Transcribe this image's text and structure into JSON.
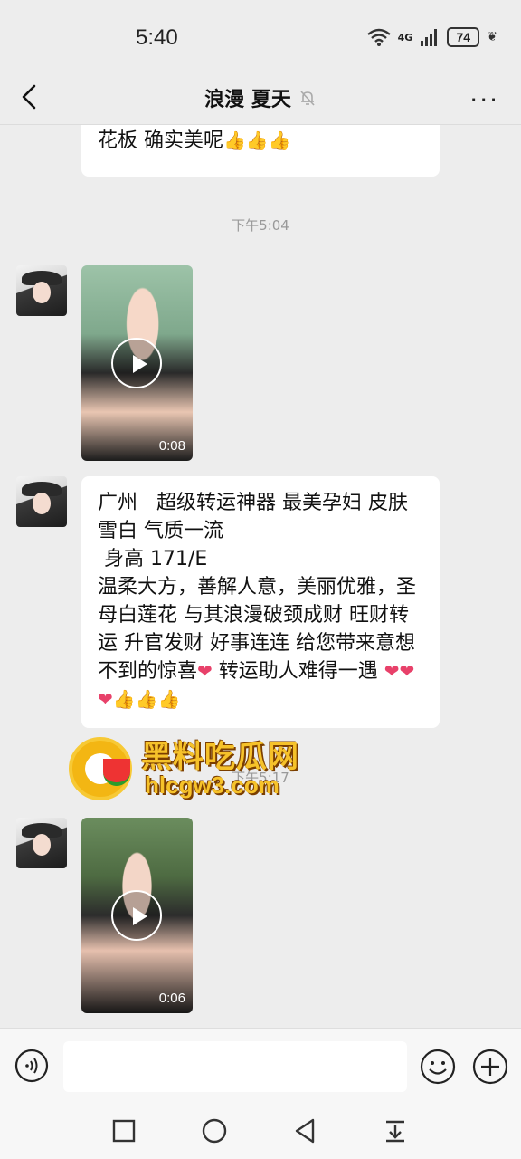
{
  "status_bar": {
    "time": "5:40",
    "network": "4G",
    "battery": "74"
  },
  "header": {
    "title": "浪漫 夏天",
    "back_icon": "chevron-left-icon",
    "mute_icon": "bell-muted-icon",
    "more_label": "···"
  },
  "messages": {
    "top_bubble_text": "花板 确实美呢",
    "timestamp_1": "下午5:04",
    "video_1_duration": "0:08",
    "main_text": "广州   超级转运神器 最美孕妇 皮肤雪白 气质一流\n 身高 171/E\n温柔大方，善解人意，美丽优雅，圣母白莲花 与其浪漫破颈成财 旺财转运 升官发财 好事连连 给您带来意想不到的惊喜",
    "main_text_tail_1": " 转运助人难得一遇 ",
    "timestamp_2": "下午5:17",
    "video_2_duration": "0:06"
  },
  "watermark": {
    "title": "黑料吃瓜网",
    "url": "hlcgw3.com"
  },
  "input_bar": {
    "placeholder": ""
  },
  "colors": {
    "background": "#ededed",
    "bubble": "#ffffff",
    "watermark": "#f6c22a"
  }
}
